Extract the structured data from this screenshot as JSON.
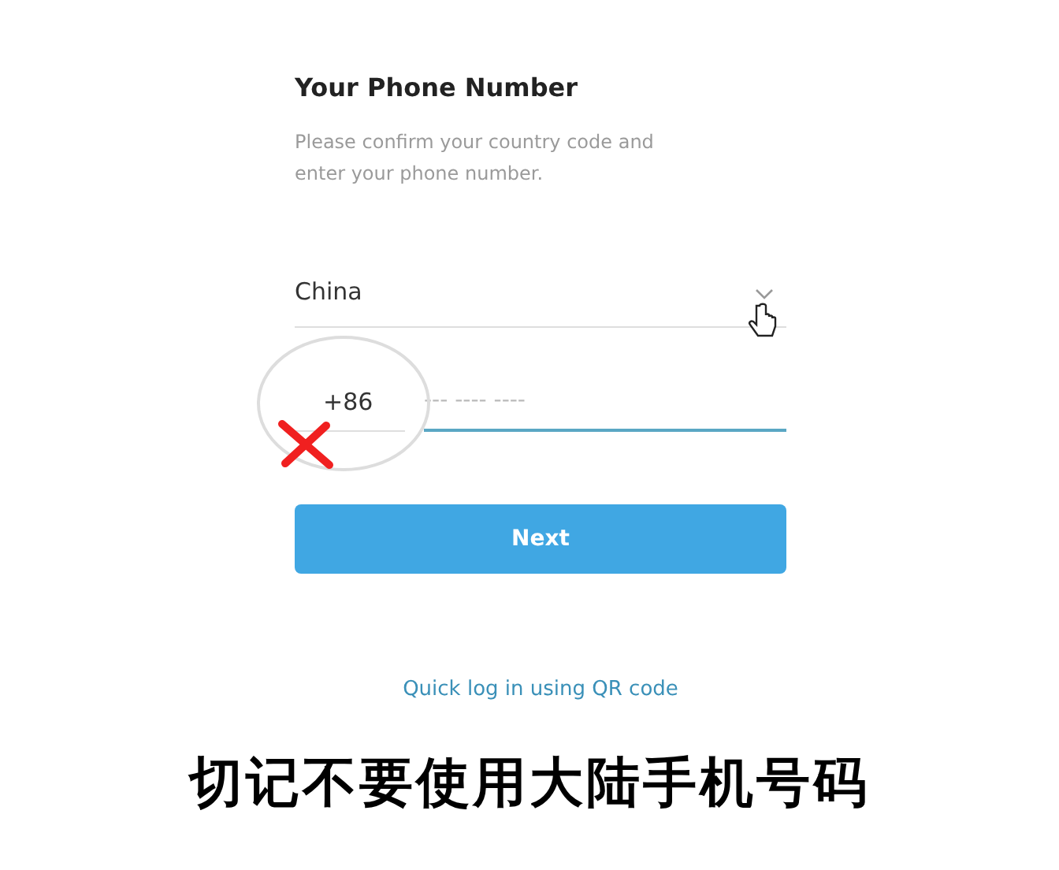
{
  "title": "Your Phone Number",
  "subtitle": "Please confirm your country code and enter your phone number.",
  "country": {
    "value": "China"
  },
  "code": {
    "value": "+86"
  },
  "phone": {
    "placeholder": "--- ---- ----",
    "focused": true
  },
  "next_button": "Next",
  "qr_link": "Quick log in using QR code",
  "caption": "切记不要使用大陆手机号码"
}
